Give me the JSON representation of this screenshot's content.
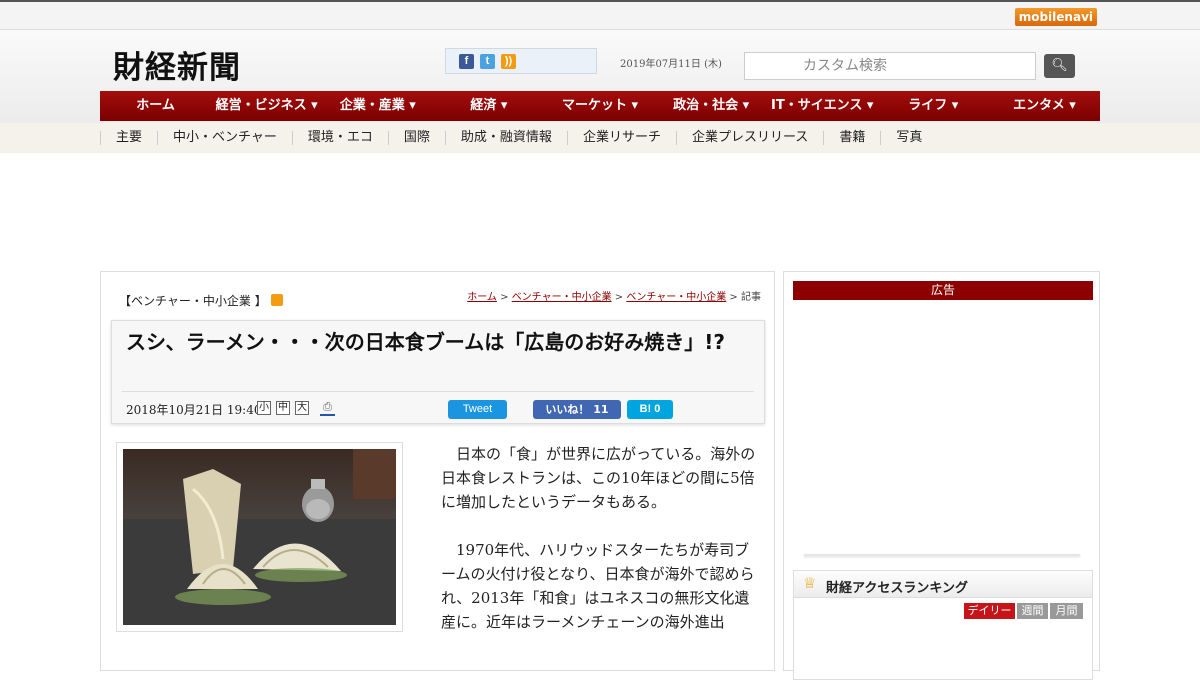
{
  "topbar": {
    "mobilenavi_label": "mobilenavi"
  },
  "header": {
    "logo": "財経新聞",
    "date": "2019年07月11日 (木)",
    "search_placeholder": "カスタム検索"
  },
  "nav": [
    "ホーム",
    "経営・ビジネス ▾",
    "企業・産業 ▾",
    "経済 ▾",
    "マーケット ▾",
    "政治・社会 ▾",
    "IT・サイエンス ▾",
    "ライフ ▾",
    "エンタメ ▾"
  ],
  "subnav": [
    "主要",
    "中小・ベンチャー",
    "環境・エコ",
    "国際",
    "助成・融資情報",
    "企業リサーチ",
    "企業プレスリリース",
    "書籍",
    "写真"
  ],
  "article": {
    "category": "【ベンチャー・中小企業 】",
    "breadcrumb": {
      "home": "ホーム",
      "sep1": " > ",
      "cat1": "ベンチャー・中小企業",
      "sep2": " > ",
      "cat2": "ベンチャー・中小企業",
      "sep3": " > ",
      "current": "記事"
    },
    "title": "スシ、ラーメン・・・次の日本食ブームは「広島のお好み焼き」!?",
    "date": "2018年10月21日 19:40",
    "font_small": "小",
    "font_medium": "中",
    "font_large": "大",
    "tweet_label": "Tweet",
    "like_label": "いいね！ 11",
    "hatena_label": "B! 0",
    "paragraphs": [
      "日本の「食」が世界に広がっている。海外の日本食レストランは、この10年ほどの間に5倍に増加したというデータもある。",
      "1970年代、ハリウッドスターたちが寿司ブームの火付け役となり、日本食が海外で認められ、2013年「和食」はユネスコの無形文化遺産に。近年はラーメンチェーンの海外進出"
    ]
  },
  "sidebar": {
    "ad_label": "広告",
    "ranking_title": "財経アクセスランキング",
    "tabs": [
      "デイリー",
      "週間",
      "月間"
    ]
  },
  "icons": [
    "facebook-icon",
    "twitter-icon",
    "rss-icon",
    "search-icon",
    "print-icon",
    "crown-icon"
  ],
  "colors": {
    "brand_red": "#8c0000",
    "nav_red": "#a30d0d",
    "tab_active": "#c5141a"
  }
}
